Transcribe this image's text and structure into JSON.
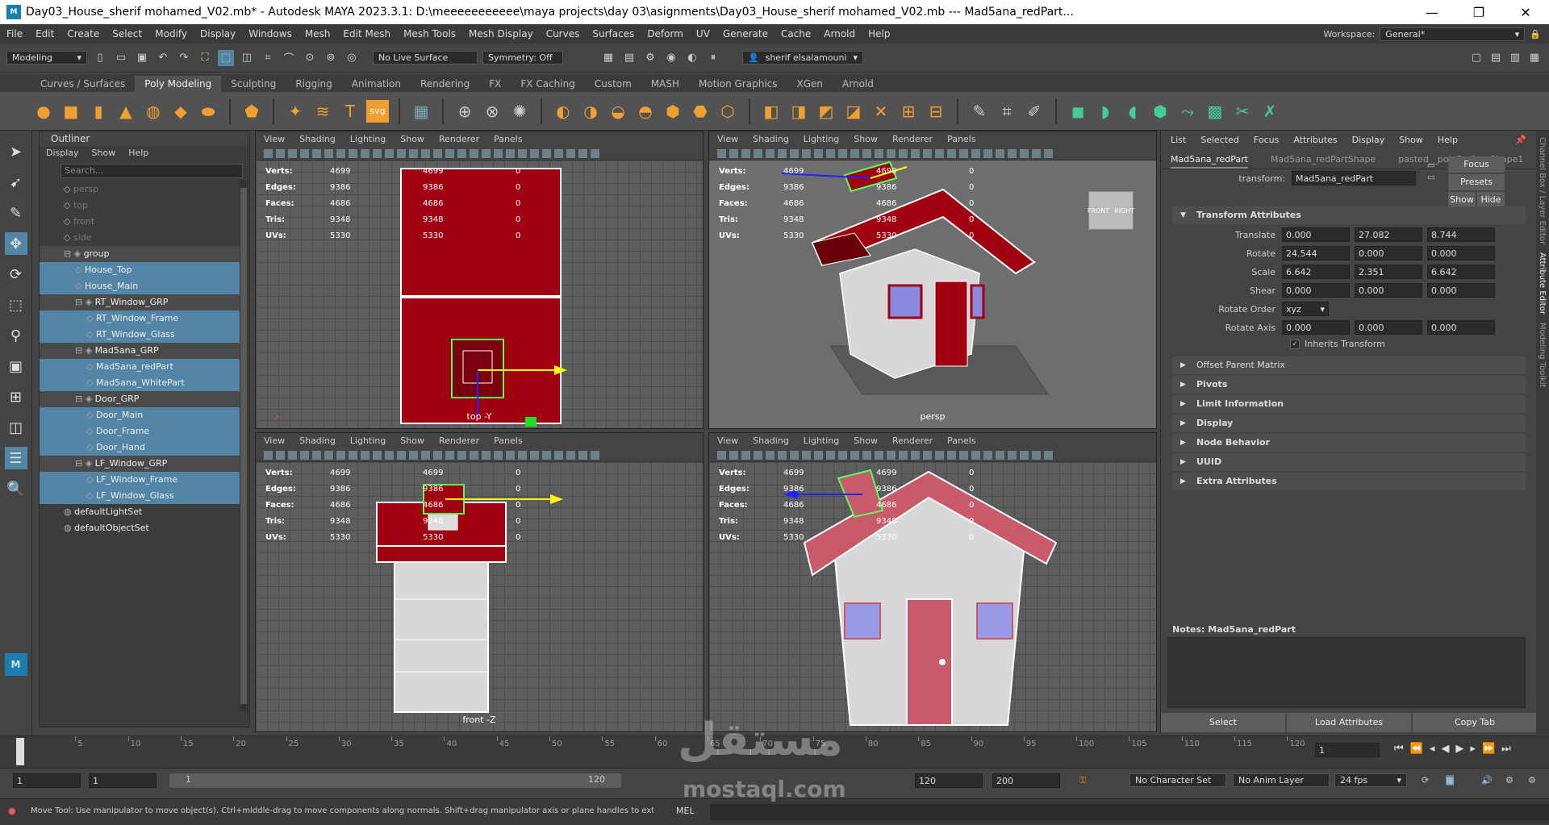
{
  "window": {
    "title": "Day03_House_sherif mohamed_V02.mb* - Autodesk MAYA 2023.3.1: D:\\meeeeeeeeeee\\maya projects\\day 03\\asignments\\Day03_House_sherif mohamed_V02.mb   ---   Mad5ana_redPart...",
    "app_icon": "M",
    "controls": [
      "—",
      "❐",
      "✕"
    ]
  },
  "menubar": {
    "items": [
      "File",
      "Edit",
      "Create",
      "Select",
      "Modify",
      "Display",
      "Windows",
      "Mesh",
      "Edit Mesh",
      "Mesh Tools",
      "Mesh Display",
      "Curves",
      "Surfaces",
      "Deform",
      "UV",
      "Generate",
      "Cache",
      "Arnold",
      "Help"
    ],
    "workspace_label": "Workspace:",
    "workspace_value": "General*"
  },
  "statusline": {
    "menu_set": "Modeling",
    "live_surface": "No Live Surface",
    "symmetry": "Symmetry: Off",
    "user": "sherif elsalamouni"
  },
  "shelf": {
    "tabs": [
      "Curves / Surfaces",
      "Poly Modeling",
      "Sculpting",
      "Rigging",
      "Animation",
      "Rendering",
      "FX",
      "FX Caching",
      "Custom",
      "MASH",
      "Motion Graphics",
      "XGen",
      "Arnold"
    ],
    "active_tab": "Poly Modeling"
  },
  "outliner": {
    "title": "Outliner",
    "menu": [
      "Display",
      "Show",
      "Help"
    ],
    "search_placeholder": "Search...",
    "rows": [
      {
        "label": "persp",
        "indent": 1,
        "style": "dim"
      },
      {
        "label": "top",
        "indent": 1,
        "style": "dim"
      },
      {
        "label": "front",
        "indent": 1,
        "style": "dim"
      },
      {
        "label": "side",
        "indent": 1,
        "style": "dim"
      },
      {
        "label": "group",
        "indent": 1,
        "style": "grp"
      },
      {
        "label": "House_Top",
        "indent": 2,
        "style": "hl"
      },
      {
        "label": "House_Main",
        "indent": 2,
        "style": "hl"
      },
      {
        "label": "RT_Window_GRP",
        "indent": 2,
        "style": "grp"
      },
      {
        "label": "RT_Window_Frame",
        "indent": 3,
        "style": "hl"
      },
      {
        "label": "RT_Window_Glass",
        "indent": 3,
        "style": "hl"
      },
      {
        "label": "Mad5ana_GRP",
        "indent": 2,
        "style": "grp"
      },
      {
        "label": "Mad5ana_redPart",
        "indent": 3,
        "style": "hl"
      },
      {
        "label": "Mad5ana_WhitePart",
        "indent": 3,
        "style": "hl"
      },
      {
        "label": "Door_GRP",
        "indent": 2,
        "style": "grp"
      },
      {
        "label": "Door_Main",
        "indent": 3,
        "style": "hl"
      },
      {
        "label": "Door_Frame",
        "indent": 3,
        "style": "hl"
      },
      {
        "label": "Door_Hand",
        "indent": 3,
        "style": "hl"
      },
      {
        "label": "LF_Window_GRP",
        "indent": 2,
        "style": "grp"
      },
      {
        "label": "LF_Window_Frame",
        "indent": 3,
        "style": "hl"
      },
      {
        "label": "LF_Window_Glass",
        "indent": 3,
        "style": "hl"
      },
      {
        "label": "defaultLightSet",
        "indent": 1,
        "style": "plain"
      },
      {
        "label": "defaultObjectSet",
        "indent": 1,
        "style": "plain"
      }
    ]
  },
  "viewport_menu": [
    "View",
    "Shading",
    "Lighting",
    "Show",
    "Renderer",
    "Panels"
  ],
  "hud": {
    "rows": [
      {
        "k": "Verts:",
        "a": "4699",
        "b": "4699",
        "c": "0"
      },
      {
        "k": "Edges:",
        "a": "9386",
        "b": "9386",
        "c": "0"
      },
      {
        "k": "Faces:",
        "a": "4686",
        "b": "4686",
        "c": "0"
      },
      {
        "k": "Tris:",
        "a": "9348",
        "b": "9348",
        "c": "0"
      },
      {
        "k": "UVs:",
        "a": "5330",
        "b": "5330",
        "c": "0"
      }
    ]
  },
  "viewports": {
    "top_label": "top -Y",
    "persp_label": "persp",
    "front_label": "front -Z",
    "viewcube_front": "FRONT",
    "viewcube_right": "RIGHT"
  },
  "attribute_editor": {
    "menu": [
      "List",
      "Selected",
      "Focus",
      "Attributes",
      "Display",
      "Show",
      "Help"
    ],
    "tabs": [
      "Mad5ana_redPart",
      "Mad5ana_redPartShape",
      "pasted__polySurfaceShape1"
    ],
    "transform_label": "transform:",
    "transform_value": "Mad5ana_redPart",
    "buttons": {
      "focus": "Focus",
      "presets": "Presets",
      "show": "Show",
      "hide": "Hide"
    },
    "section_transform": "Transform Attributes",
    "translate": {
      "label": "Translate",
      "x": "0.000",
      "y": "27.082",
      "z": "8.744"
    },
    "rotate": {
      "label": "Rotate",
      "x": "24.544",
      "y": "0.000",
      "z": "0.000"
    },
    "scale": {
      "label": "Scale",
      "x": "6.642",
      "y": "2.351",
      "z": "6.642"
    },
    "shear": {
      "label": "Shear",
      "x": "0.000",
      "y": "0.000",
      "z": "0.000"
    },
    "rotate_order": {
      "label": "Rotate Order",
      "value": "xyz"
    },
    "rotate_axis": {
      "label": "Rotate Axis",
      "x": "0.000",
      "y": "0.000",
      "z": "0.000"
    },
    "inherits_transform": "Inherits Transform",
    "offset_parent_matrix": "Offset Parent Matrix",
    "sections": [
      "Pivots",
      "Limit Information",
      "Display",
      "Node Behavior",
      "UUID",
      "Extra Attributes"
    ],
    "notes_label": "Notes:  Mad5ana_redPart",
    "bottom_buttons": [
      "Select",
      "Load Attributes",
      "Copy Tab"
    ]
  },
  "side_tabs": [
    "Channel Box / Layer Editor",
    "Attribute Editor",
    "Modeling Toolkit"
  ],
  "timeline": {
    "ticks": [
      "5",
      "10",
      "15",
      "20",
      "25",
      "30",
      "35",
      "40",
      "45",
      "50",
      "55",
      "60",
      "65",
      "70",
      "75",
      "80",
      "85",
      "90",
      "95",
      "100",
      "105",
      "110",
      "115",
      "120"
    ],
    "current_frame": "1"
  },
  "range": {
    "start": "1",
    "start2": "1",
    "slider_start": "1",
    "slider_end": "120",
    "end": "120",
    "end2": "200",
    "character_set": "No Character Set",
    "anim_layer": "No Anim Layer",
    "fps": "24 fps"
  },
  "helpline": {
    "text": "Move Tool: Use manipulator to move object(s). Ctrl+middle-drag to move components along normals. Shift+drag manipulator axis or plane handles to extrude components or c",
    "lang": "MEL"
  },
  "watermark": {
    "arabic": "مستقل",
    "latin": "mostaql.com"
  }
}
